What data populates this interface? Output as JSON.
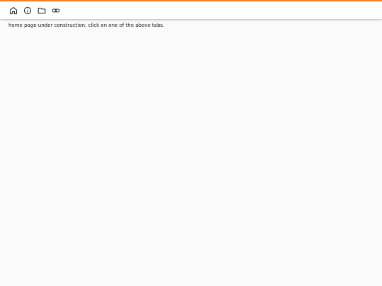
{
  "colors": {
    "accent": "#f47c2c",
    "icon": "#333333",
    "background": "#fafafa",
    "toolbar": "#ffffff"
  },
  "toolbar": {
    "tabs": [
      {
        "icon": "home-icon"
      },
      {
        "icon": "info-icon"
      },
      {
        "icon": "folder-icon"
      },
      {
        "icon": "link-icon"
      }
    ]
  },
  "main": {
    "message": "home page under construction. click on one of the above tabs."
  }
}
